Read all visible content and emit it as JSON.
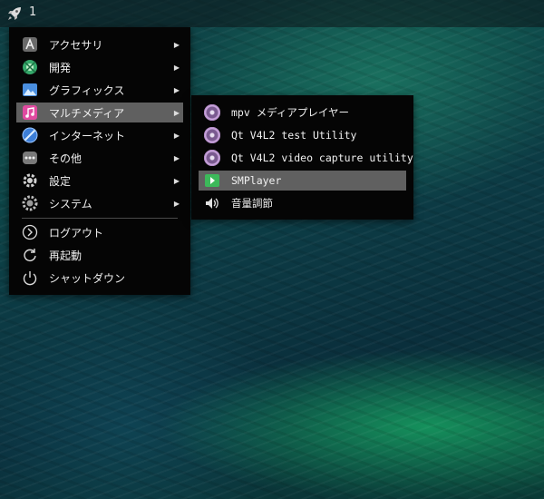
{
  "panel": {
    "workspace_number": "1"
  },
  "main_menu": {
    "items": [
      {
        "label": "アクセサリ",
        "icon": "accessories-icon",
        "has_submenu": true
      },
      {
        "label": "開発",
        "icon": "development-icon",
        "has_submenu": true
      },
      {
        "label": "グラフィックス",
        "icon": "graphics-icon",
        "has_submenu": true
      },
      {
        "label": "マルチメディア",
        "icon": "multimedia-icon",
        "has_submenu": true,
        "active": true
      },
      {
        "label": "インターネット",
        "icon": "internet-icon",
        "has_submenu": true
      },
      {
        "label": "その他",
        "icon": "other-icon",
        "has_submenu": true
      },
      {
        "label": "設定",
        "icon": "settings-icon",
        "has_submenu": true
      },
      {
        "label": "システム",
        "icon": "system-icon",
        "has_submenu": true
      }
    ],
    "session_items": [
      {
        "label": "ログアウト",
        "icon": "logout-icon"
      },
      {
        "label": "再起動",
        "icon": "reboot-icon"
      },
      {
        "label": "シャットダウン",
        "icon": "shutdown-icon"
      }
    ],
    "submenu_arrow": "▶"
  },
  "multimedia_submenu": {
    "items": [
      {
        "label": "mpv メディアプレイヤー",
        "icon": "media-disc-icon"
      },
      {
        "label": "Qt V4L2 test Utility",
        "icon": "media-disc-icon"
      },
      {
        "label": "Qt V4L2 video capture utility",
        "icon": "media-disc-icon"
      },
      {
        "label": "SMPlayer",
        "icon": "smplayer-icon",
        "active": true
      },
      {
        "label": "音量調節",
        "icon": "speaker-icon"
      }
    ]
  },
  "colors": {
    "menu_background": "#050505",
    "highlight": "#606060",
    "text": "#f0f0f0"
  }
}
